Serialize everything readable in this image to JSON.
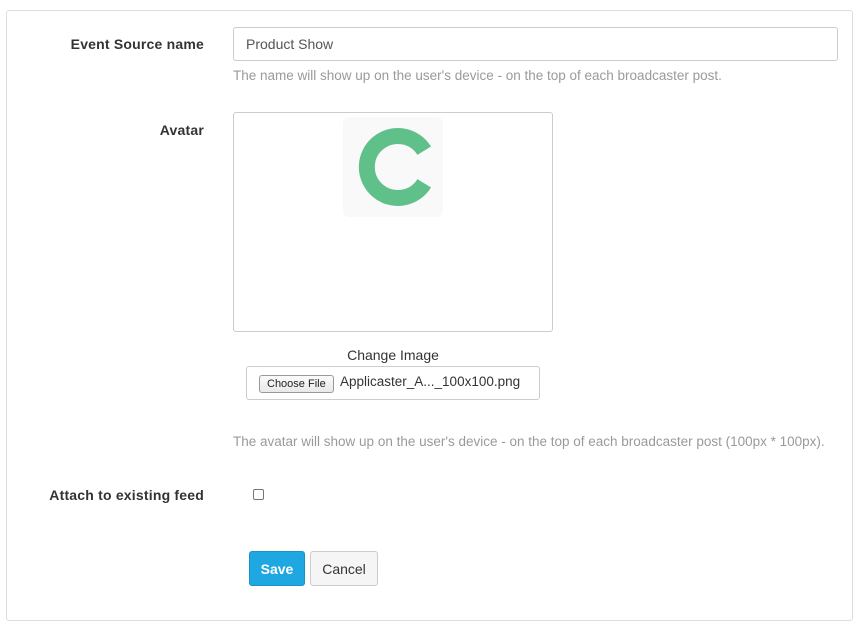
{
  "form": {
    "event_source_name": {
      "label": "Event Source name",
      "value": "Product Show",
      "help": "The name will show up on the user's device - on the top of each broadcaster post."
    },
    "avatar": {
      "label": "Avatar",
      "image_icon": "applicaster-c-logo",
      "image_color": "#5fc08a",
      "change_image_label": "Change Image",
      "choose_file_label": "Choose File",
      "file_name": "Applicaster_A..._100x100.png",
      "help": "The avatar will show up on the user's device - on the top of each broadcaster post (100px * 100px)."
    },
    "attach_feed": {
      "label": "Attach to existing feed",
      "checked": false
    },
    "actions": {
      "save_label": "Save",
      "cancel_label": "Cancel",
      "save_color": "#1ea7e1"
    }
  }
}
